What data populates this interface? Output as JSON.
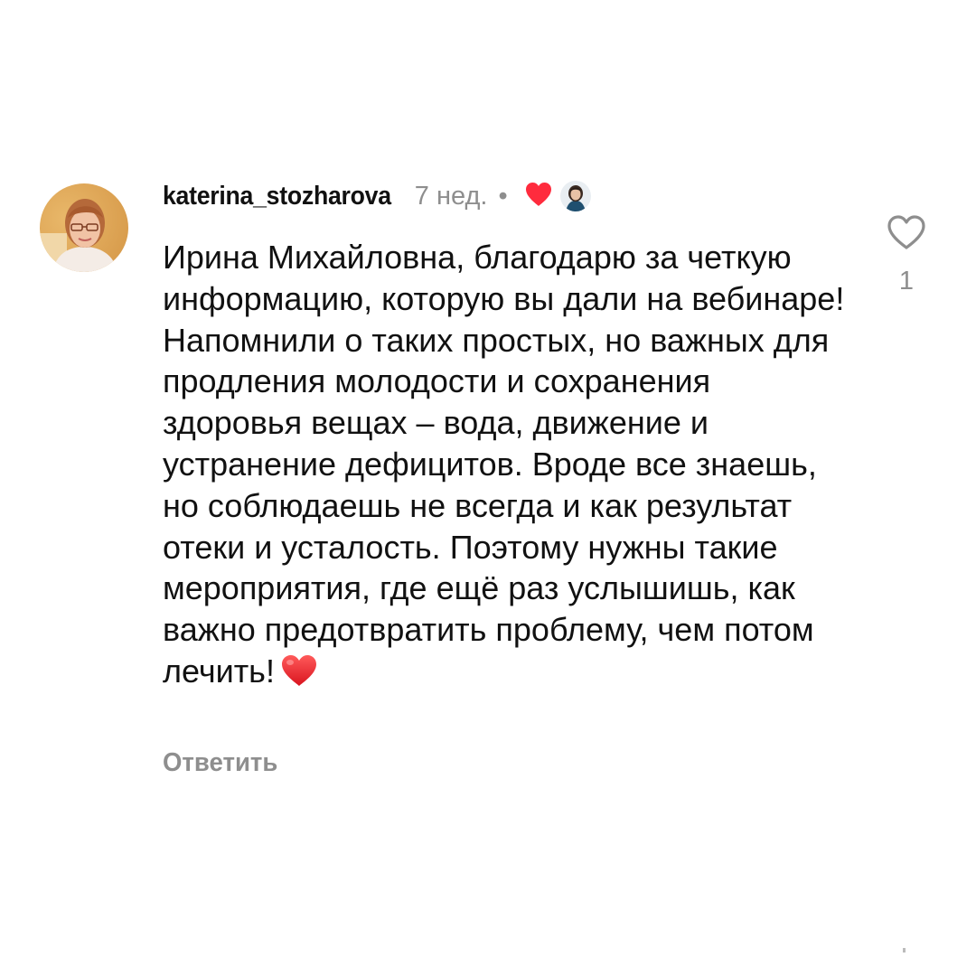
{
  "comment": {
    "username": "katerina_stozharova",
    "time": "7 нед.",
    "separator": "•",
    "text": "Ирина Михайловна, благодарю за четкую информацию, которую вы дали на вебинаре! Напомнили о таких простых, но важных для продления молодости и сохранения здоровья вещах – вода, движение и устранение дефицитов. Вроде все знаешь, но соблюдаешь не всегда и как результат отеки и усталость. Поэтому нужны такие мероприятия, где ещё раз услышишь, как важно предотвратить проблему, чем потом лечить!",
    "reply_label": "Ответить",
    "like_count": "1"
  },
  "icons": {
    "liked_by_author": "heart-filled-icon",
    "like": "heart-outline-icon",
    "text_emoji": "red-heart-emoji"
  },
  "colors": {
    "heart_red": "#ff2b3d",
    "muted_text": "#8e8e8e",
    "primary_text": "#111111"
  }
}
